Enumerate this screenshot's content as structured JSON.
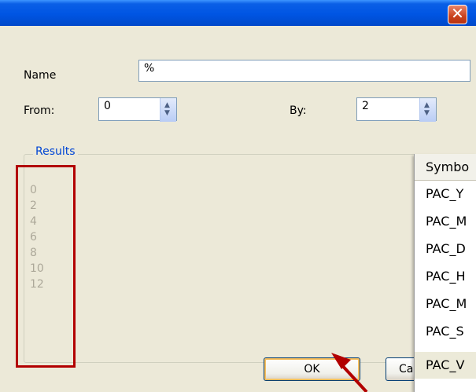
{
  "dialog": {
    "close_glyph": "✕",
    "name_label": "Name",
    "name_value": "%",
    "from_label": "From:",
    "from_value": "0",
    "by_label": "By:",
    "by_value": "2",
    "results_title": "Results",
    "results": [
      "0",
      "2",
      "4",
      "6",
      "8",
      "10",
      "12"
    ],
    "ok_label": "OK",
    "cancel_label": "Ca"
  },
  "symbol_list": {
    "header": "Symbo",
    "items": [
      "PAC_Y",
      "PAC_M",
      "PAC_D",
      "PAC_H",
      "PAC_M",
      "PAC_S",
      "PAC_V"
    ]
  },
  "colors": {
    "titlebar": "#0055e3",
    "highlight_box": "#b20000",
    "arrow": "#b20000"
  }
}
